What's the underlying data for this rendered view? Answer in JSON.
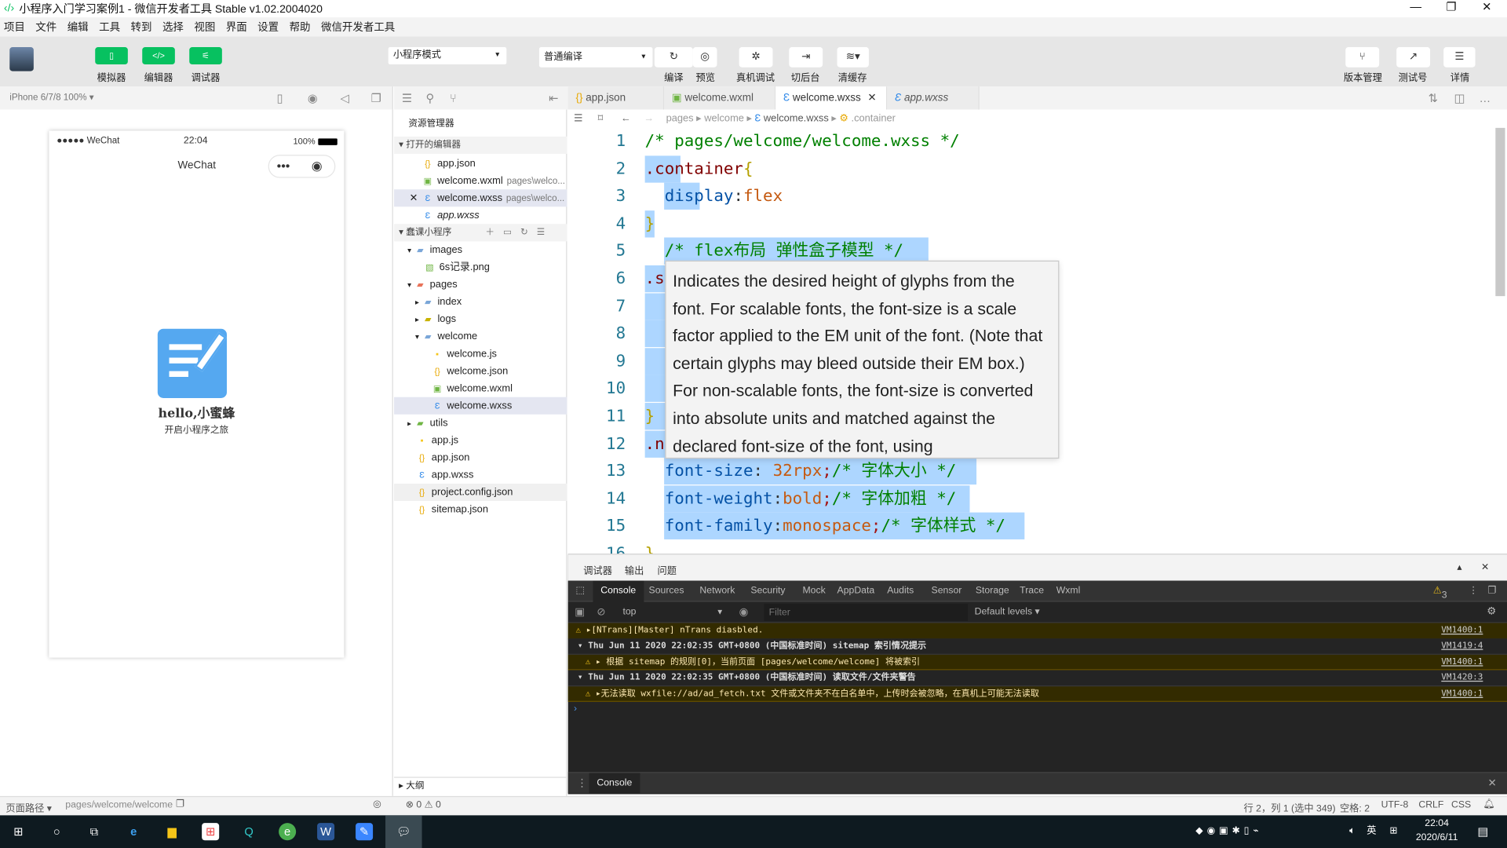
{
  "window": {
    "title": "小程序入门学习案例1 - 微信开发者工具 Stable v1.02.2004020",
    "controls": [
      "—",
      "❐",
      "✕"
    ]
  },
  "menu": [
    "项目",
    "文件",
    "编辑",
    "工具",
    "转到",
    "选择",
    "视图",
    "界面",
    "设置",
    "帮助",
    "微信开发者工具"
  ],
  "toolbar": {
    "simulator": "模拟器",
    "editor": "编辑器",
    "debugger": "调试器",
    "mode": "小程序模式",
    "compile_mode": "普通编译",
    "compile": "编译",
    "preview": "预览",
    "remote_debug": "真机调试",
    "background": "切后台",
    "clear_cache": "清缓存",
    "version": "版本管理",
    "test": "测试号",
    "details": "详情"
  },
  "simulator": {
    "device": "iPhone 6/7/8 100% ▾",
    "carrier": "●●●●● WeChat",
    "time": "22:04",
    "battery": "100%",
    "nav_title": "WeChat",
    "hello": "hello,小蜜蜂",
    "subtitle": "开启小程序之旅"
  },
  "explorer": {
    "title": "资源管理器",
    "open_editors": "打开的编辑器",
    "project": "蠢课小程序",
    "outline": "大纲",
    "open_files": [
      {
        "name": "app.json",
        "icon": "{}"
      },
      {
        "name": "welcome.wxml",
        "sub": "pages\\welco...",
        "icon": "<>"
      },
      {
        "name": "welcome.wxss",
        "sub": "pages\\welco...",
        "icon": "css"
      },
      {
        "name": "app.wxss",
        "icon": "css"
      }
    ],
    "tree": [
      {
        "name": "images",
        "type": "folder"
      },
      {
        "name": "6s记录.png",
        "type": "img"
      },
      {
        "name": "pages",
        "type": "folder"
      },
      {
        "name": "index",
        "type": "folder"
      },
      {
        "name": "logs",
        "type": "folder"
      },
      {
        "name": "welcome",
        "type": "folder"
      },
      {
        "name": "welcome.js",
        "type": "js"
      },
      {
        "name": "welcome.json",
        "type": "json"
      },
      {
        "name": "welcome.wxml",
        "type": "wxml"
      },
      {
        "name": "welcome.wxss",
        "type": "css"
      },
      {
        "name": "utils",
        "type": "folder"
      },
      {
        "name": "app.js",
        "type": "js"
      },
      {
        "name": "app.json",
        "type": "json"
      },
      {
        "name": "app.wxss",
        "type": "css"
      },
      {
        "name": "project.config.json",
        "type": "json"
      },
      {
        "name": "sitemap.json",
        "type": "json"
      }
    ]
  },
  "tabs": [
    "app.json",
    "welcome.wxml",
    "welcome.wxss",
    "app.wxss"
  ],
  "breadcrumb": [
    "pages",
    "welcome",
    "welcome.wxss",
    ".container"
  ],
  "code": [
    "/* pages/welcome/welcome.wxss */",
    ".container{",
    "  display:flex",
    "}",
    "  /* flex布局 弹性盒子模型 */",
    ".s",
    "",
    "",
    "",
    "",
    "}",
    ".n",
    "  font-size: 32rpx;/* 字体大小 */",
    "  font-weight:bold;/* 字体加粗 */",
    "  font-family:monospace;/* 字体样式 */",
    "}"
  ],
  "tooltip": "Indicates the desired height of glyphs from the font. For scalable fonts, the font-size is a scale factor applied to the EM unit of the font. (Note that certain glyphs may bleed outside their EM box.) For non-scalable fonts, the font-size is converted into absolute units and matched against the declared font-size of the font, using",
  "devtools": {
    "panel_tabs": [
      "调试器",
      "输出",
      "问题"
    ],
    "tabs": [
      "Console",
      "Sources",
      "Network",
      "Security",
      "Mock",
      "AppData",
      "Audits",
      "Sensor",
      "Storage",
      "Trace",
      "Wxml"
    ],
    "warn_count": "3",
    "context": "top",
    "filter_placeholder": "Filter",
    "levels": "Default levels ▾",
    "drawer_tab": "Console",
    "logs": [
      {
        "type": "warn",
        "text": "▸[NTrans][Master] nTrans diasbled.",
        "src": "VM1400:1"
      },
      {
        "type": "group",
        "text": "▾ Thu Jun 11 2020 22:02:35 GMT+0800 (中国标准时间) sitemap 索引情况提示",
        "src": "VM1419:4"
      },
      {
        "type": "warn",
        "text": "  ▸ 根据 sitemap 的规则[0]，当前页面 [pages/welcome/welcome] 将被索引",
        "src": "VM1400:1"
      },
      {
        "type": "group",
        "text": "▾ Thu Jun 11 2020 22:02:35 GMT+0800 (中国标准时间) 读取文件/文件夹警告",
        "src": "VM1420:3"
      },
      {
        "type": "warn",
        "text": "  ▸无法读取 wxfile://ad/ad_fetch.txt 文件或文件夹不在白名单中，上传时会被忽略，在真机上可能无法读取",
        "src": "VM1400:1"
      }
    ]
  },
  "status": {
    "page_path_label": "页面路径 ▾",
    "page_path": "pages/welcome/welcome",
    "problems": "⊗ 0 ⚠ 0",
    "cursor": "行 2，列 1 (选中 349)",
    "spaces": "空格: 2",
    "encoding": "UTF-8",
    "eol": "CRLF",
    "lang": "CSS"
  },
  "taskbar": {
    "time": "22:04",
    "date": "2020/6/11",
    "ime": "英"
  },
  "colors": {
    "accent": "#07c160",
    "selection": "#add6ff"
  }
}
